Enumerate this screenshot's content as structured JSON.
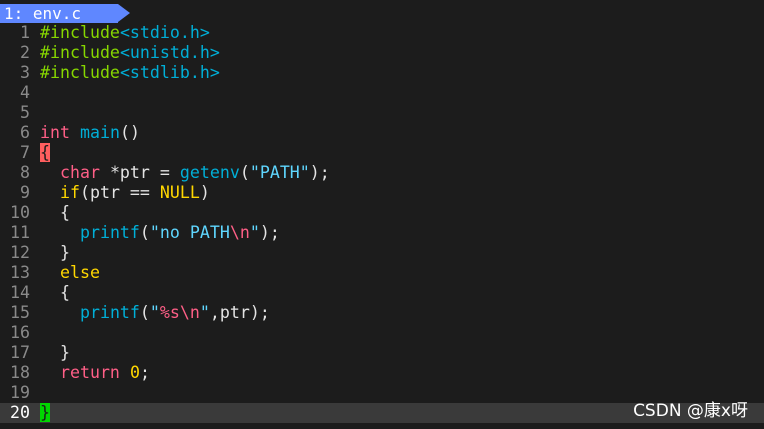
{
  "tab": {
    "label": "1: env.c"
  },
  "colors": {
    "tab_bg": "#5f87ff",
    "background": "#1c1c1c",
    "current_line_bg": "#3a3a3a"
  },
  "lines": [
    {
      "n": "1",
      "tokens": [
        {
          "t": "#include",
          "c": "c-pre"
        },
        {
          "t": "<stdio.h>",
          "c": "c-inc"
        }
      ]
    },
    {
      "n": "2",
      "tokens": [
        {
          "t": "#include",
          "c": "c-pre"
        },
        {
          "t": "<unistd.h>",
          "c": "c-inc"
        }
      ]
    },
    {
      "n": "3",
      "tokens": [
        {
          "t": "#include",
          "c": "c-pre"
        },
        {
          "t": "<stdlib.h>",
          "c": "c-inc"
        }
      ]
    },
    {
      "n": "4",
      "tokens": []
    },
    {
      "n": "5",
      "tokens": []
    },
    {
      "n": "6",
      "tokens": [
        {
          "t": "int",
          "c": "c-type"
        },
        {
          "t": " ",
          "c": "c-plain"
        },
        {
          "t": "main",
          "c": "c-fn"
        },
        {
          "t": "()",
          "c": "c-plain"
        }
      ]
    },
    {
      "n": "7",
      "tokens": [
        {
          "t": "{",
          "c": "c-bracket-red"
        }
      ]
    },
    {
      "n": "8",
      "tokens": [
        {
          "t": "  ",
          "c": "c-plain"
        },
        {
          "t": "char",
          "c": "c-type"
        },
        {
          "t": " *ptr = ",
          "c": "c-plain"
        },
        {
          "t": "getenv",
          "c": "c-fn"
        },
        {
          "t": "(",
          "c": "c-plain"
        },
        {
          "t": "\"PATH\"",
          "c": "c-str"
        },
        {
          "t": ");",
          "c": "c-plain"
        }
      ]
    },
    {
      "n": "9",
      "tokens": [
        {
          "t": "  ",
          "c": "c-plain"
        },
        {
          "t": "if",
          "c": "c-kw"
        },
        {
          "t": "(ptr == ",
          "c": "c-plain"
        },
        {
          "t": "NULL",
          "c": "c-const"
        },
        {
          "t": ")",
          "c": "c-plain"
        }
      ]
    },
    {
      "n": "10",
      "tokens": [
        {
          "t": "  {",
          "c": "c-plain"
        }
      ]
    },
    {
      "n": "11",
      "tokens": [
        {
          "t": "    ",
          "c": "c-plain"
        },
        {
          "t": "printf",
          "c": "c-fn"
        },
        {
          "t": "(",
          "c": "c-plain"
        },
        {
          "t": "\"no PATH",
          "c": "c-str"
        },
        {
          "t": "\\n",
          "c": "c-esc"
        },
        {
          "t": "\"",
          "c": "c-str"
        },
        {
          "t": ");",
          "c": "c-plain"
        }
      ]
    },
    {
      "n": "12",
      "tokens": [
        {
          "t": "  }",
          "c": "c-plain"
        }
      ]
    },
    {
      "n": "13",
      "tokens": [
        {
          "t": "  ",
          "c": "c-plain"
        },
        {
          "t": "else",
          "c": "c-kw"
        }
      ]
    },
    {
      "n": "14",
      "tokens": [
        {
          "t": "  {",
          "c": "c-plain"
        }
      ]
    },
    {
      "n": "15",
      "tokens": [
        {
          "t": "    ",
          "c": "c-plain"
        },
        {
          "t": "printf",
          "c": "c-fn"
        },
        {
          "t": "(",
          "c": "c-plain"
        },
        {
          "t": "\"",
          "c": "c-str"
        },
        {
          "t": "%s\\n",
          "c": "c-esc"
        },
        {
          "t": "\"",
          "c": "c-str"
        },
        {
          "t": ",ptr);",
          "c": "c-plain"
        }
      ]
    },
    {
      "n": "16",
      "tokens": []
    },
    {
      "n": "17",
      "tokens": [
        {
          "t": "  }",
          "c": "c-plain"
        }
      ]
    },
    {
      "n": "18",
      "tokens": [
        {
          "t": "  ",
          "c": "c-plain"
        },
        {
          "t": "return",
          "c": "c-ret"
        },
        {
          "t": " ",
          "c": "c-plain"
        },
        {
          "t": "0",
          "c": "c-num"
        },
        {
          "t": ";",
          "c": "c-plain"
        }
      ]
    },
    {
      "n": "19",
      "tokens": []
    },
    {
      "n": "20",
      "current": true,
      "tokens": [
        {
          "t": "}",
          "c": "c-bracket-green"
        }
      ]
    }
  ],
  "watermark": "CSDN @康x呀"
}
